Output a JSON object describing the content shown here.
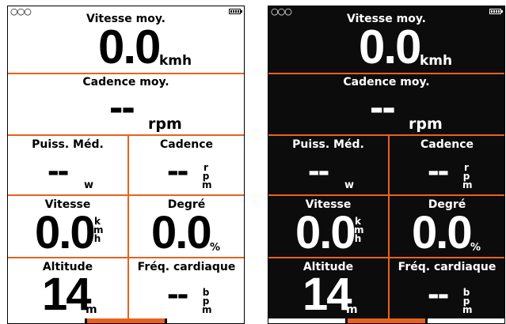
{
  "status": {
    "dots": "○○○",
    "battery_icon": "battery-full"
  },
  "accent_color": "#e8621e",
  "fields": {
    "avg_speed": {
      "label": "Vitesse moy.",
      "value": "0.0",
      "unit": "kmh"
    },
    "avg_cadence": {
      "label": "Cadence moy.",
      "value": "--",
      "unit": "rpm"
    },
    "avg_power": {
      "label": "Puiss. Méd.",
      "value": "--",
      "unit": "w"
    },
    "cadence": {
      "label": "Cadence",
      "value": "--",
      "unit": [
        "r",
        "p",
        "m"
      ]
    },
    "speed": {
      "label": "Vitesse",
      "value": "0.0",
      "unit": [
        "k",
        "m",
        "h"
      ]
    },
    "grade": {
      "label": "Degré",
      "value": "0.0",
      "unit": "%"
    },
    "altitude": {
      "label": "Altitude",
      "value": "14",
      "unit": "m"
    },
    "heart_rate": {
      "label": "Fréq. cardiaque",
      "value": "--",
      "unit": [
        "b",
        "p",
        "m"
      ]
    }
  },
  "pages": {
    "count": 3,
    "active": 2
  }
}
